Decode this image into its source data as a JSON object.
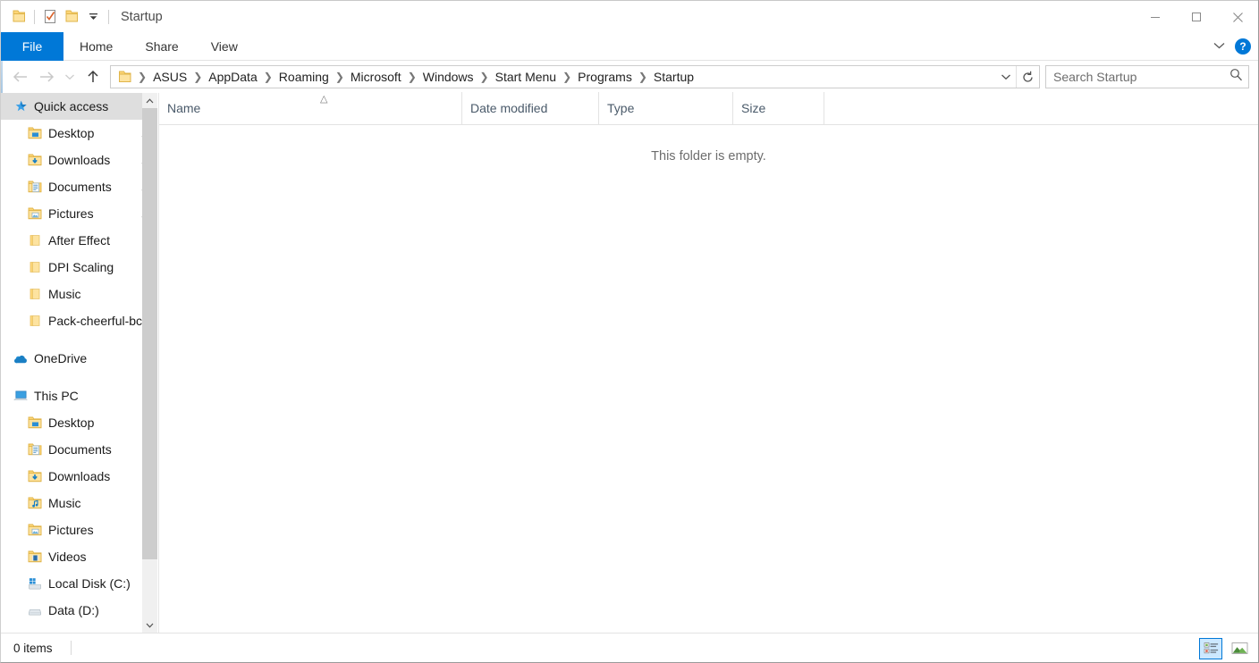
{
  "window": {
    "title": "Startup",
    "quick_access_toolbar": [
      {
        "name": "properties-folder-icon",
        "label": "Properties"
      },
      {
        "name": "new-folder-checkbox-icon",
        "label": "New folder"
      },
      {
        "name": "folder-icon",
        "label": "Folder"
      },
      {
        "name": "customize-quick-access-chevron-icon",
        "label": "Customize Quick Access Toolbar"
      }
    ],
    "controls": {
      "minimize": "—",
      "maximize": "□",
      "close": "✕"
    }
  },
  "ribbon": {
    "tabs": [
      {
        "label": "File",
        "active": true
      },
      {
        "label": "Home",
        "active": false
      },
      {
        "label": "Share",
        "active": false
      },
      {
        "label": "View",
        "active": false
      }
    ],
    "expand_label": "Expand the Ribbon",
    "help_label": "?"
  },
  "navigation": {
    "back_label": "Back",
    "forward_label": "Forward",
    "recent_label": "Recent locations",
    "up_label": "Up",
    "breadcrumbs": [
      "ASUS",
      "AppData",
      "Roaming",
      "Microsoft",
      "Windows",
      "Start Menu",
      "Programs",
      "Startup"
    ],
    "address_dropdown_label": "Previous locations",
    "refresh_label": "Refresh"
  },
  "search": {
    "placeholder": "Search Startup",
    "value": "",
    "icon": "search-icon"
  },
  "sidebar": {
    "groups": [
      {
        "name": "quick-access",
        "header": {
          "label": "Quick access",
          "icon": "star-pin-icon",
          "selected": true
        },
        "items": [
          {
            "label": "Desktop",
            "icon": "folder-desktop-icon",
            "pinned": true
          },
          {
            "label": "Downloads",
            "icon": "folder-downloads-icon",
            "pinned": true
          },
          {
            "label": "Documents",
            "icon": "folder-documents-icon",
            "pinned": true
          },
          {
            "label": "Pictures",
            "icon": "folder-pictures-icon",
            "pinned": true
          },
          {
            "label": "After Effect",
            "icon": "folder-icon",
            "pinned": false
          },
          {
            "label": "DPI Scaling",
            "icon": "folder-icon",
            "pinned": false
          },
          {
            "label": "Music",
            "icon": "folder-icon",
            "pinned": false
          },
          {
            "label": "Pack-cheerful-bc",
            "icon": "folder-icon",
            "pinned": false
          }
        ]
      },
      {
        "name": "onedrive",
        "header": {
          "label": "OneDrive",
          "icon": "onedrive-cloud-icon",
          "selected": false
        },
        "items": []
      },
      {
        "name": "this-pc",
        "header": {
          "label": "This PC",
          "icon": "this-pc-icon",
          "selected": false
        },
        "items": [
          {
            "label": "Desktop",
            "icon": "folder-desktop-icon",
            "pinned": false
          },
          {
            "label": "Documents",
            "icon": "folder-documents-icon",
            "pinned": false
          },
          {
            "label": "Downloads",
            "icon": "folder-downloads-icon",
            "pinned": false
          },
          {
            "label": "Music",
            "icon": "folder-music-icon",
            "pinned": false
          },
          {
            "label": "Pictures",
            "icon": "folder-pictures-icon",
            "pinned": false
          },
          {
            "label": "Videos",
            "icon": "folder-videos-icon",
            "pinned": false
          },
          {
            "label": "Local Disk (C:)",
            "icon": "windows-drive-icon",
            "pinned": false
          },
          {
            "label": "Data (D:)",
            "icon": "drive-icon",
            "pinned": false
          }
        ]
      }
    ]
  },
  "filelist": {
    "columns": [
      {
        "label": "Name",
        "sorted": "ascending"
      },
      {
        "label": "Date modified",
        "sorted": ""
      },
      {
        "label": "Type",
        "sorted": ""
      },
      {
        "label": "Size",
        "sorted": ""
      }
    ],
    "rows": [],
    "empty_message": "This folder is empty."
  },
  "statusbar": {
    "item_count": "0 items",
    "views": [
      {
        "name": "details-view",
        "label": "Details view",
        "active": true
      },
      {
        "name": "large-icons-view",
        "label": "Large icons view",
        "active": false
      }
    ]
  },
  "colors": {
    "accent": "#0078d7",
    "folder": "#fcd577",
    "folder_edge": "#e8b84b",
    "selection": "#dedede",
    "header_text": "#4a5a6a"
  }
}
